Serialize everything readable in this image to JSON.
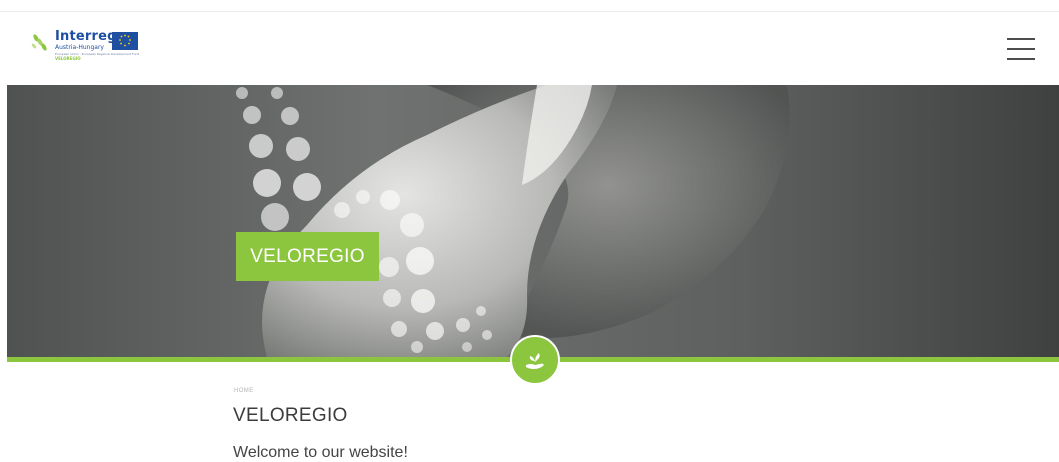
{
  "header": {
    "logo": {
      "brand": "Interreg",
      "region": "Austria-Hungary",
      "fund_line": "European Union · European Regional Development Fund",
      "project": "VELOREGIO"
    },
    "menu_icon": "hamburger-menu-icon"
  },
  "hero": {
    "label": "VELOREGIO",
    "badge_icon": "hand-with-sprout-icon"
  },
  "content": {
    "breadcrumb": "HOME",
    "title": "VELOREGIO",
    "welcome": "Welcome to our website!"
  },
  "colors": {
    "accent_green": "#8cc63f",
    "brand_blue": "#1f4fa0",
    "text_dark": "#3c3c3c"
  }
}
